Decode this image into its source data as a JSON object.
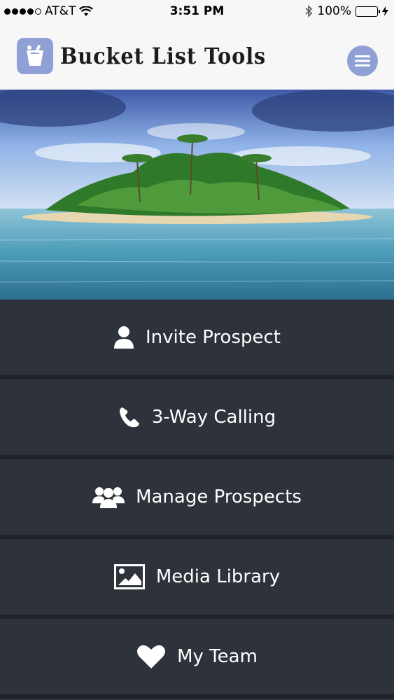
{
  "status_bar": {
    "carrier": "AT&T",
    "time": "3:51 PM",
    "battery_percent": "100%"
  },
  "header": {
    "logo_text": "Bucket List Tools",
    "menu_icon": "hamburger-icon"
  },
  "hero": {
    "image": "tropical-island-image"
  },
  "menu": {
    "items": [
      {
        "label": "Invite Prospect",
        "icon": "person-icon"
      },
      {
        "label": "3-Way Calling",
        "icon": "phone-icon"
      },
      {
        "label": "Manage Prospects",
        "icon": "group-icon"
      },
      {
        "label": "Media Library",
        "icon": "image-icon"
      },
      {
        "label": "My Team",
        "icon": "heart-icon"
      }
    ]
  },
  "colors": {
    "accent": "#8fa0d6",
    "menu_background": "#2e323a",
    "battery": "#2ecc40"
  }
}
